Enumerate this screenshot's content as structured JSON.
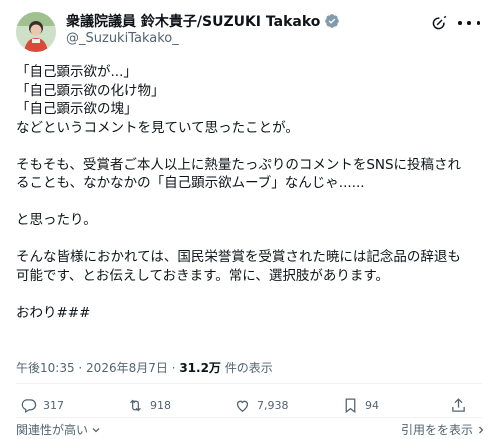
{
  "author": {
    "display_name": "衆議院議員 鈴木貴子/SUZUKI Takako",
    "handle": "@_SuzukiTakako_",
    "verified_icon": "verified-badge-icon",
    "avatar_icon": "profile-avatar"
  },
  "header_icons": [
    "grok-icon",
    "more-icon"
  ],
  "body_lines": [
    "「自己顕示欲が...」",
    "「自己顕示欲の化け物」",
    "「自己顕示欲の塊」",
    "などというコメントを見ていて思ったことが。",
    "",
    "そもそも、受賞者ご本人以上に熱量たっぷりのコメントをSNSに投稿され",
    "ることも、なかなかの「自己顕示欲ムーブ」なんじゃ......",
    "",
    "と思ったり。",
    "",
    "そんな皆様におかれては、国民栄誉賞を受賞された暁には記念品の辞退も",
    "可能です、とお伝えしておきます。常に、選択肢があります。",
    "",
    "おわり###"
  ],
  "meta": {
    "time": "午後10:35",
    "separator": " · ",
    "date": "2026年8月7日",
    "views_count": "31.2万",
    "views_label": " 件の表示"
  },
  "actions": {
    "reply": {
      "icon": "reply-icon",
      "count": "317"
    },
    "repost": {
      "icon": "repost-icon",
      "count": "918"
    },
    "like": {
      "icon": "like-icon",
      "count": "7,938"
    },
    "bookmark": {
      "icon": "bookmark-icon",
      "count": "94"
    },
    "share": {
      "icon": "share-icon"
    }
  },
  "footer": {
    "sort_label": "関連性が高い",
    "quotes_label": "引用をを表示"
  },
  "colors": {
    "text": "#0f1419",
    "secondary": "#536471",
    "verified": "#829aab",
    "divider": "#eff3f4"
  }
}
